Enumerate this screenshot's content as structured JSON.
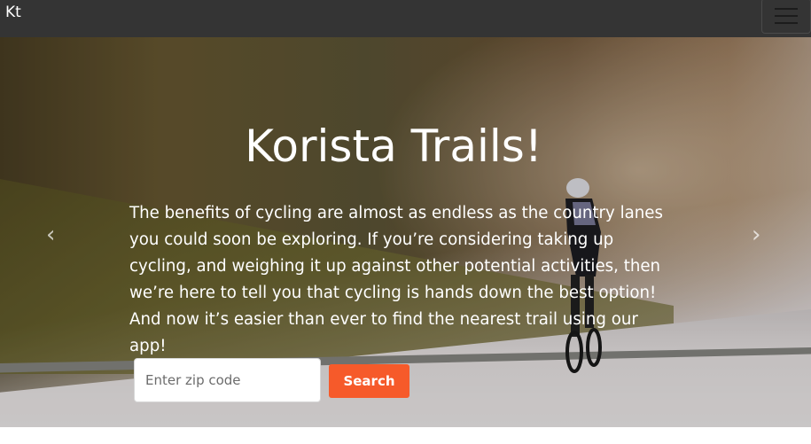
{
  "navbar": {
    "brand": "Kt",
    "toggler_icon": "hamburger-menu-icon"
  },
  "hero": {
    "title": "Korista Trails!",
    "description": "The benefits of cycling are almost as endless as the country lanes you could soon be exploring. If you’re considering taking up cycling, and weighing it up against other potential activities, then we’re here to tell you that cycling is hands down the best option! And now it’s easier than ever to find the nearest trail using our app!",
    "prev_arrow": "‹",
    "next_arrow": "›",
    "prev_icon": "chevron-left-icon",
    "next_icon": "chevron-right-icon"
  },
  "search": {
    "zip_placeholder": "Enter zip code",
    "zip_value": "",
    "button_label": "Search"
  },
  "colors": {
    "navbar": "#343434",
    "accent": "#f65a2a",
    "text_on_hero": "#ffffff"
  }
}
